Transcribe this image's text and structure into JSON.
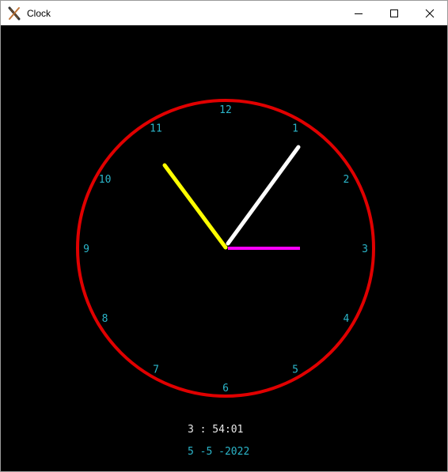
{
  "window": {
    "title": "Clock",
    "icon": "x-app-icon",
    "controls": [
      "minimize",
      "maximize",
      "close"
    ]
  },
  "clock": {
    "dial_numbers": [
      "12",
      "1",
      "2",
      "3",
      "4",
      "5",
      "6",
      "7",
      "8",
      "9",
      "10",
      "11"
    ],
    "colors": {
      "background": "#000000",
      "ring": "#e00000",
      "numerals": "#2bb5c9",
      "hour_hand": "#ff00ff",
      "minute_hand": "#ffffff",
      "second_hand": "#ffff00",
      "time_text": "#e8e8e8",
      "date_text": "#2bb5c9"
    },
    "time_display": "3 : 54:01",
    "date_display": "5 -5 -2022"
  }
}
